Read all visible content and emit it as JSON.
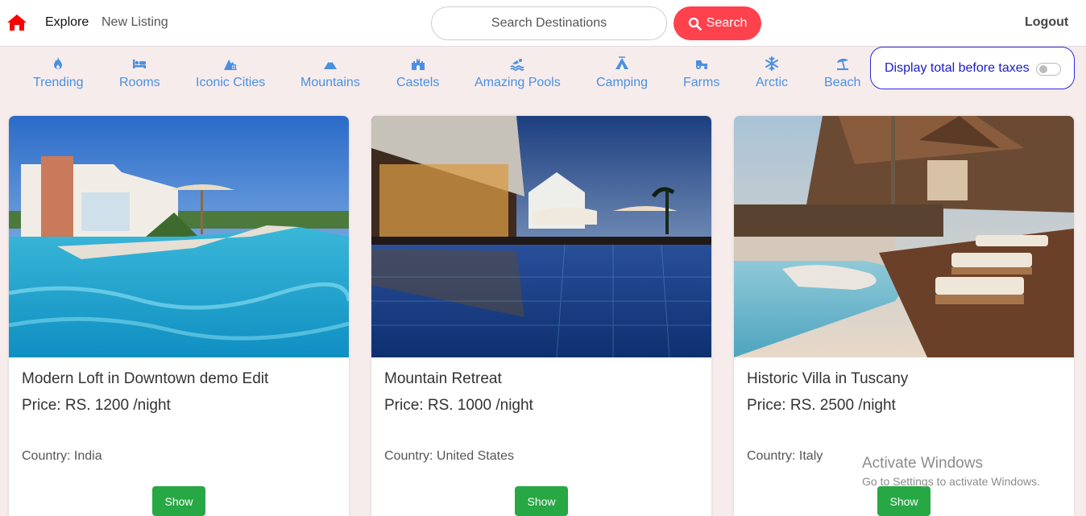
{
  "navbar": {
    "home_icon": "house-icon",
    "brand_color": "#fe424d",
    "links": [
      "Explore",
      "New Listing"
    ],
    "search_placeholder": "Search Destinations",
    "search_button": "Search",
    "logout": "Logout"
  },
  "filters": [
    {
      "label": "Trending",
      "icon": "fire-icon"
    },
    {
      "label": "Rooms",
      "icon": "bed-icon"
    },
    {
      "label": "Iconic Cities",
      "icon": "city-icon"
    },
    {
      "label": "Mountains",
      "icon": "mountain-icon"
    },
    {
      "label": "Castels",
      "icon": "castle-icon"
    },
    {
      "label": "Amazing Pools",
      "icon": "pool-icon"
    },
    {
      "label": "Camping",
      "icon": "tent-icon"
    },
    {
      "label": "Farms",
      "icon": "tractor-icon"
    },
    {
      "label": "Arctic",
      "icon": "snowflake-icon"
    },
    {
      "label": "Beach",
      "icon": "umbrella-beach-icon"
    }
  ],
  "tax_toggle": {
    "label": "Display total before taxes",
    "checked": false
  },
  "listings": [
    {
      "title": "Modern Loft in Downtown demo Edit",
      "price": "Price: RS. 1200 /night",
      "country": "Country: India",
      "button": "Show"
    },
    {
      "title": "Mountain Retreat",
      "price": "Price: RS. 1000 /night",
      "country": "Country: United States",
      "button": "Show"
    },
    {
      "title": "Historic Villa in Tuscany",
      "price": "Price: RS. 2500 /night",
      "country": "Country: Italy",
      "button": "Show"
    }
  ],
  "watermark": {
    "title": "Activate Windows",
    "subtitle": "Go to Settings to activate Windows."
  }
}
